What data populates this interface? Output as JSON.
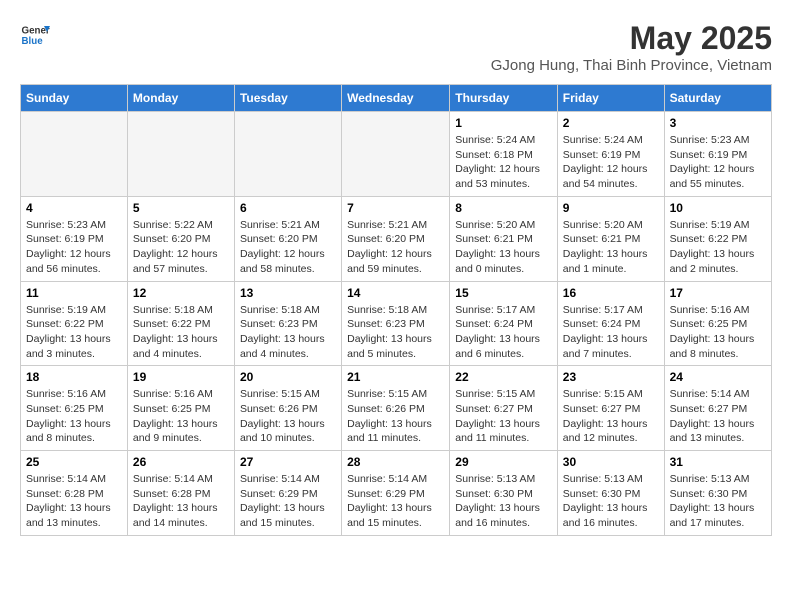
{
  "header": {
    "logo_general": "General",
    "logo_blue": "Blue",
    "month": "May 2025",
    "location": "GJong Hung, Thai Binh Province, Vietnam"
  },
  "days_of_week": [
    "Sunday",
    "Monday",
    "Tuesday",
    "Wednesday",
    "Thursday",
    "Friday",
    "Saturday"
  ],
  "weeks": [
    [
      {
        "day": "",
        "empty": true
      },
      {
        "day": "",
        "empty": true
      },
      {
        "day": "",
        "empty": true
      },
      {
        "day": "",
        "empty": true
      },
      {
        "day": "1",
        "sunrise": "5:24 AM",
        "sunset": "6:18 PM",
        "daylight": "12 hours and 53 minutes."
      },
      {
        "day": "2",
        "sunrise": "5:24 AM",
        "sunset": "6:19 PM",
        "daylight": "12 hours and 54 minutes."
      },
      {
        "day": "3",
        "sunrise": "5:23 AM",
        "sunset": "6:19 PM",
        "daylight": "12 hours and 55 minutes."
      }
    ],
    [
      {
        "day": "4",
        "sunrise": "5:23 AM",
        "sunset": "6:19 PM",
        "daylight": "12 hours and 56 minutes."
      },
      {
        "day": "5",
        "sunrise": "5:22 AM",
        "sunset": "6:20 PM",
        "daylight": "12 hours and 57 minutes."
      },
      {
        "day": "6",
        "sunrise": "5:21 AM",
        "sunset": "6:20 PM",
        "daylight": "12 hours and 58 minutes."
      },
      {
        "day": "7",
        "sunrise": "5:21 AM",
        "sunset": "6:20 PM",
        "daylight": "12 hours and 59 minutes."
      },
      {
        "day": "8",
        "sunrise": "5:20 AM",
        "sunset": "6:21 PM",
        "daylight": "13 hours and 0 minutes."
      },
      {
        "day": "9",
        "sunrise": "5:20 AM",
        "sunset": "6:21 PM",
        "daylight": "13 hours and 1 minute."
      },
      {
        "day": "10",
        "sunrise": "5:19 AM",
        "sunset": "6:22 PM",
        "daylight": "13 hours and 2 minutes."
      }
    ],
    [
      {
        "day": "11",
        "sunrise": "5:19 AM",
        "sunset": "6:22 PM",
        "daylight": "13 hours and 3 minutes."
      },
      {
        "day": "12",
        "sunrise": "5:18 AM",
        "sunset": "6:22 PM",
        "daylight": "13 hours and 4 minutes."
      },
      {
        "day": "13",
        "sunrise": "5:18 AM",
        "sunset": "6:23 PM",
        "daylight": "13 hours and 4 minutes."
      },
      {
        "day": "14",
        "sunrise": "5:18 AM",
        "sunset": "6:23 PM",
        "daylight": "13 hours and 5 minutes."
      },
      {
        "day": "15",
        "sunrise": "5:17 AM",
        "sunset": "6:24 PM",
        "daylight": "13 hours and 6 minutes."
      },
      {
        "day": "16",
        "sunrise": "5:17 AM",
        "sunset": "6:24 PM",
        "daylight": "13 hours and 7 minutes."
      },
      {
        "day": "17",
        "sunrise": "5:16 AM",
        "sunset": "6:25 PM",
        "daylight": "13 hours and 8 minutes."
      }
    ],
    [
      {
        "day": "18",
        "sunrise": "5:16 AM",
        "sunset": "6:25 PM",
        "daylight": "13 hours and 8 minutes."
      },
      {
        "day": "19",
        "sunrise": "5:16 AM",
        "sunset": "6:25 PM",
        "daylight": "13 hours and 9 minutes."
      },
      {
        "day": "20",
        "sunrise": "5:15 AM",
        "sunset": "6:26 PM",
        "daylight": "13 hours and 10 minutes."
      },
      {
        "day": "21",
        "sunrise": "5:15 AM",
        "sunset": "6:26 PM",
        "daylight": "13 hours and 11 minutes."
      },
      {
        "day": "22",
        "sunrise": "5:15 AM",
        "sunset": "6:27 PM",
        "daylight": "13 hours and 11 minutes."
      },
      {
        "day": "23",
        "sunrise": "5:15 AM",
        "sunset": "6:27 PM",
        "daylight": "13 hours and 12 minutes."
      },
      {
        "day": "24",
        "sunrise": "5:14 AM",
        "sunset": "6:27 PM",
        "daylight": "13 hours and 13 minutes."
      }
    ],
    [
      {
        "day": "25",
        "sunrise": "5:14 AM",
        "sunset": "6:28 PM",
        "daylight": "13 hours and 13 minutes."
      },
      {
        "day": "26",
        "sunrise": "5:14 AM",
        "sunset": "6:28 PM",
        "daylight": "13 hours and 14 minutes."
      },
      {
        "day": "27",
        "sunrise": "5:14 AM",
        "sunset": "6:29 PM",
        "daylight": "13 hours and 15 minutes."
      },
      {
        "day": "28",
        "sunrise": "5:14 AM",
        "sunset": "6:29 PM",
        "daylight": "13 hours and 15 minutes."
      },
      {
        "day": "29",
        "sunrise": "5:13 AM",
        "sunset": "6:30 PM",
        "daylight": "13 hours and 16 minutes."
      },
      {
        "day": "30",
        "sunrise": "5:13 AM",
        "sunset": "6:30 PM",
        "daylight": "13 hours and 16 minutes."
      },
      {
        "day": "31",
        "sunrise": "5:13 AM",
        "sunset": "6:30 PM",
        "daylight": "13 hours and 17 minutes."
      }
    ]
  ]
}
